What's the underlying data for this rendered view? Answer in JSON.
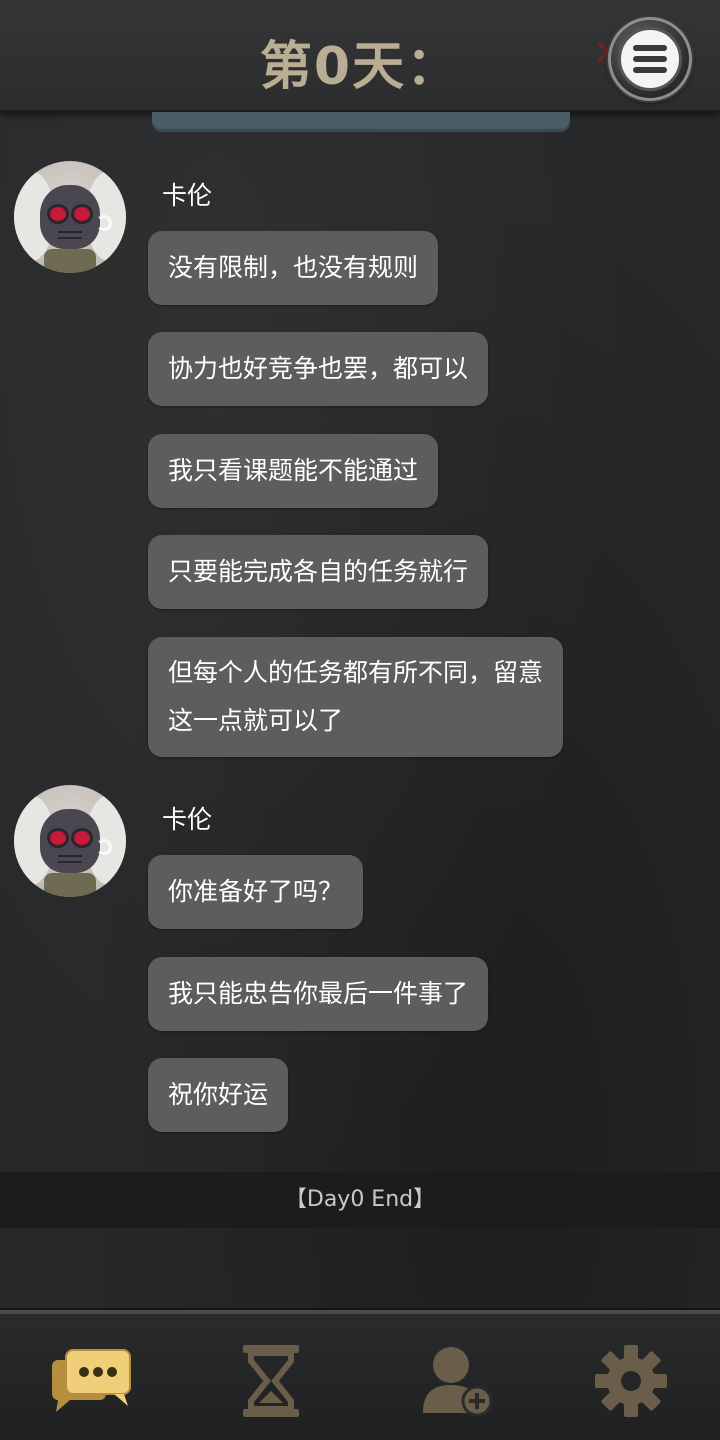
{
  "header": {
    "title": "第0天："
  },
  "messages": [
    {
      "sender": "卡伦",
      "avatar": "skull-mask-avatar",
      "bubbles": [
        "没有限制，也没有规则",
        "协力也好竞争也罢，都可以",
        "我只看课题能不能通过",
        "只要能完成各自的任务就行",
        "但每个人的任务都有所不同，留意\n这一点就可以了"
      ]
    },
    {
      "sender": "卡伦",
      "avatar": "skull-mask-avatar",
      "bubbles": [
        "你准备好了吗？",
        "我只能忠告你最后一件事了",
        "祝你好运"
      ]
    }
  ],
  "end_marker": "【Day0 End】",
  "bottom_nav": [
    {
      "name": "chat",
      "icon": "chat-bubbles-icon",
      "active": true
    },
    {
      "name": "timer",
      "icon": "hourglass-icon",
      "active": false
    },
    {
      "name": "add-contact",
      "icon": "add-user-icon",
      "active": false
    },
    {
      "name": "settings",
      "icon": "gear-icon",
      "active": false
    }
  ],
  "colors": {
    "title": "#b9ad93",
    "bubble": "#5d5d5d",
    "active_icon": "#e6c26a",
    "inactive_icon": "#6a5e4a"
  }
}
